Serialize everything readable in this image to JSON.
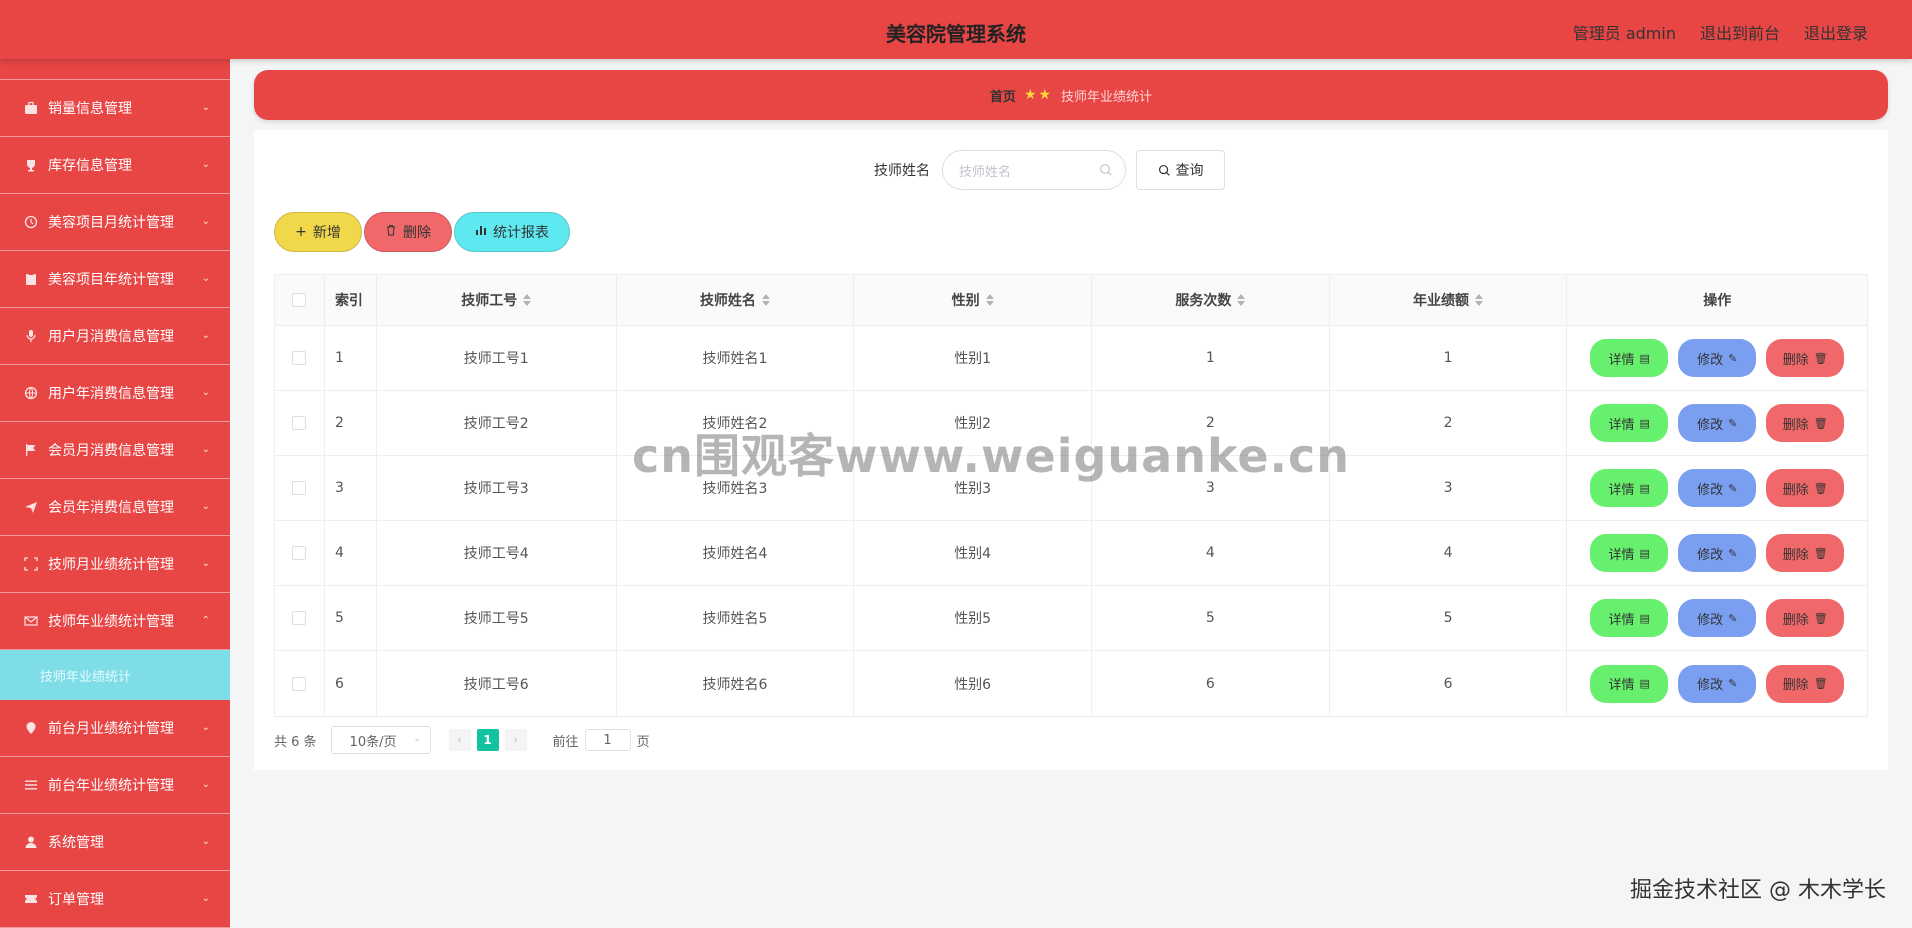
{
  "header": {
    "title": "美容院管理系统",
    "admin_label": "管理员 admin",
    "front_link": "退出到前台",
    "logout_link": "退出登录"
  },
  "sidebar": {
    "items": [
      {
        "label": "销量信息管理",
        "icon": "briefcase-icon"
      },
      {
        "label": "库存信息管理",
        "icon": "trophy-icon"
      },
      {
        "label": "美容项目月统计管理",
        "icon": "clock-icon"
      },
      {
        "label": "美容项目年统计管理",
        "icon": "clipboard-icon"
      },
      {
        "label": "用户月消费信息管理",
        "icon": "mic-icon"
      },
      {
        "label": "用户年消费信息管理",
        "icon": "globe-icon"
      },
      {
        "label": "会员月消费信息管理",
        "icon": "flag-icon"
      },
      {
        "label": "会员年消费信息管理",
        "icon": "send-icon"
      },
      {
        "label": "技师月业绩统计管理",
        "icon": "frame-icon"
      },
      {
        "label": "技师年业绩统计管理",
        "icon": "mail-icon"
      },
      {
        "label": "前台月业绩统计管理",
        "icon": "location-icon"
      },
      {
        "label": "前台年业绩统计管理",
        "icon": "list-icon"
      },
      {
        "label": "系统管理",
        "icon": "user-icon"
      },
      {
        "label": "订单管理",
        "icon": "ticket-icon"
      }
    ],
    "submenu_label": "技师年业绩统计"
  },
  "breadcrumb": {
    "home": "首页",
    "current": "技师年业绩统计"
  },
  "search": {
    "label": "技师姓名",
    "placeholder": "技师姓名",
    "button": "查询"
  },
  "actions": {
    "add": "新增",
    "delete": "删除",
    "report": "统计报表"
  },
  "table": {
    "headers": {
      "index": "索引",
      "tech_no": "技师工号",
      "tech_name": "技师姓名",
      "gender": "性别",
      "service_count": "服务次数",
      "annual_sales": "年业绩额",
      "ops": "操作"
    },
    "rows": [
      {
        "index": "1",
        "tech_no": "技师工号1",
        "tech_name": "技师姓名1",
        "gender": "性别1",
        "service_count": "1",
        "annual_sales": "1"
      },
      {
        "index": "2",
        "tech_no": "技师工号2",
        "tech_name": "技师姓名2",
        "gender": "性别2",
        "service_count": "2",
        "annual_sales": "2"
      },
      {
        "index": "3",
        "tech_no": "技师工号3",
        "tech_name": "技师姓名3",
        "gender": "性别3",
        "service_count": "3",
        "annual_sales": "3"
      },
      {
        "index": "4",
        "tech_no": "技师工号4",
        "tech_name": "技师姓名4",
        "gender": "性别4",
        "service_count": "4",
        "annual_sales": "4"
      },
      {
        "index": "5",
        "tech_no": "技师工号5",
        "tech_name": "技师姓名5",
        "gender": "性别5",
        "service_count": "5",
        "annual_sales": "5"
      },
      {
        "index": "6",
        "tech_no": "技师工号6",
        "tech_name": "技师姓名6",
        "gender": "性别6",
        "service_count": "6",
        "annual_sales": "6"
      }
    ],
    "op_labels": {
      "detail": "详情",
      "edit": "修改",
      "remove": "删除"
    }
  },
  "pagination": {
    "total": "共 6 条",
    "page_size": "10条/页",
    "current_page": "1",
    "goto_prefix": "前往",
    "goto_value": "1",
    "goto_suffix": "页"
  },
  "watermarks": {
    "center": "cn围观客www.weiguanke.cn",
    "corner": "掘金技术社区 @ 木木学长"
  },
  "colors": {
    "primary_red": "#e84545",
    "submenu_cyan": "#7fdde8",
    "btn_yellow": "#f0d84a",
    "btn_red": "#f0686a",
    "btn_cyan": "#5ee9f1",
    "btn_green": "#67f06d",
    "btn_blue": "#7a9ff0",
    "page_active": "#13c2a0"
  }
}
